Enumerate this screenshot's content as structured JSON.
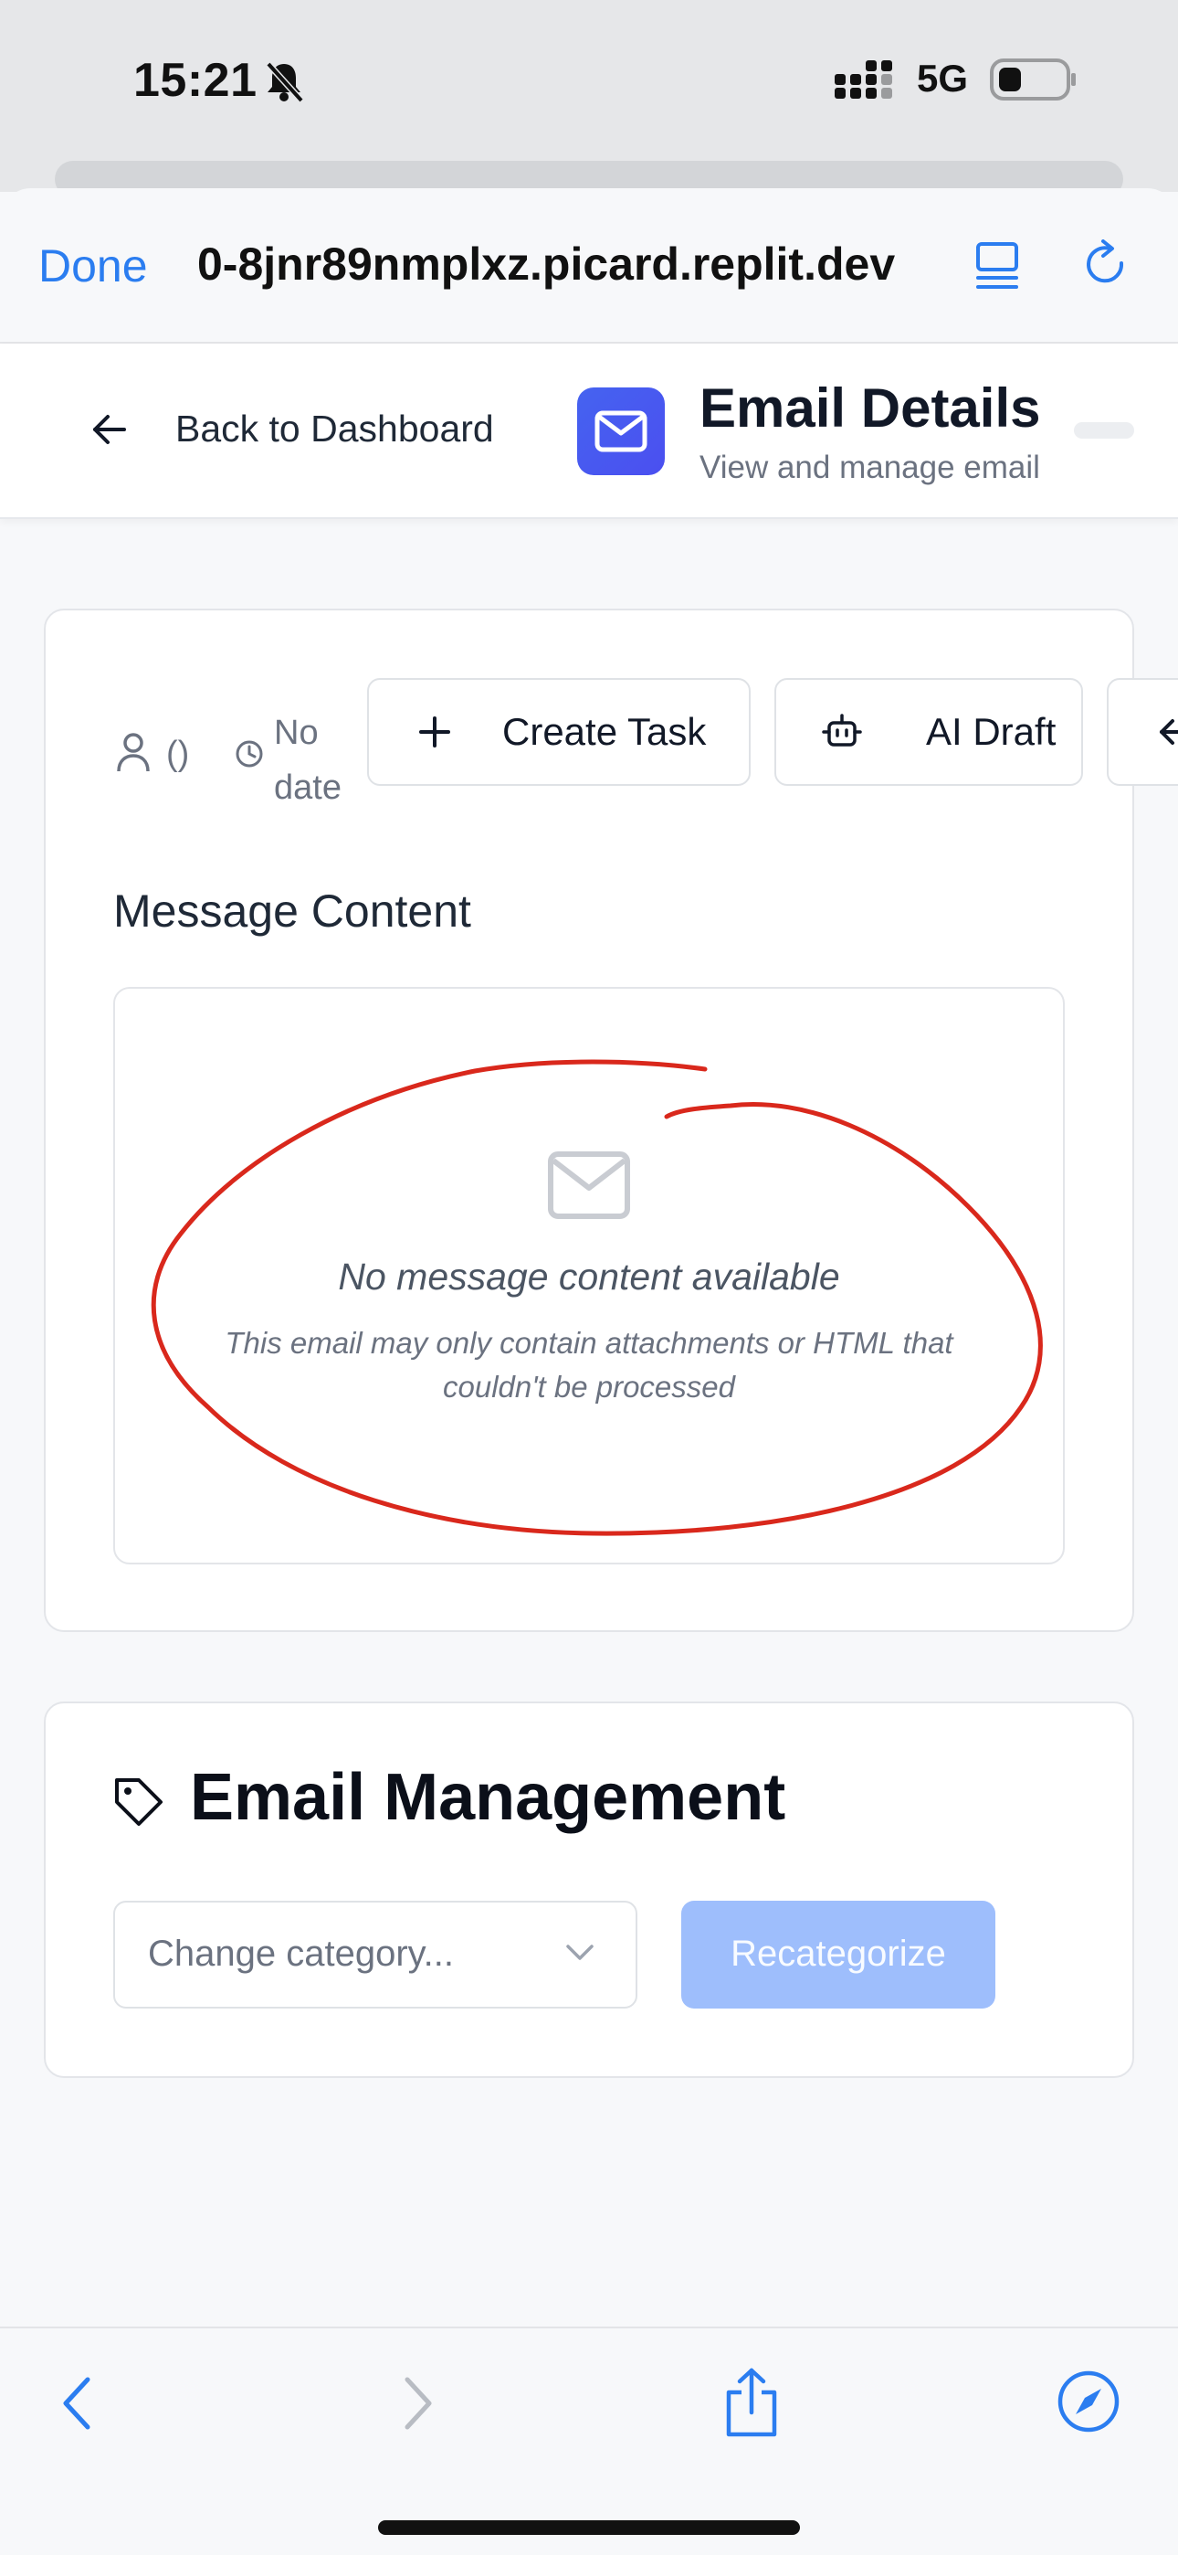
{
  "status_bar": {
    "time": "15:21",
    "network": "5G"
  },
  "browser": {
    "done_label": "Done",
    "url": "0-8jnr89nmplxz.picard.replit.dev"
  },
  "header": {
    "back_label": "Back to Dashboard",
    "title": "Email Details",
    "subtitle": "View and manage email"
  },
  "email": {
    "sender": "()",
    "date": "No date",
    "actions": {
      "create_task": "Create Task",
      "ai_draft": "AI Draft"
    },
    "section_title": "Message Content",
    "empty_title": "No message content available",
    "empty_description": "This email may only contain attachments or HTML that couldn't be processed"
  },
  "management": {
    "title": "Email Management",
    "category_placeholder": "Change category...",
    "recategorize_label": "Recategorize"
  },
  "colors": {
    "accent": "#2b7df0",
    "annotation": "#d9281c",
    "badge": "#4563f0",
    "disabled_button": "#9ebefc"
  }
}
